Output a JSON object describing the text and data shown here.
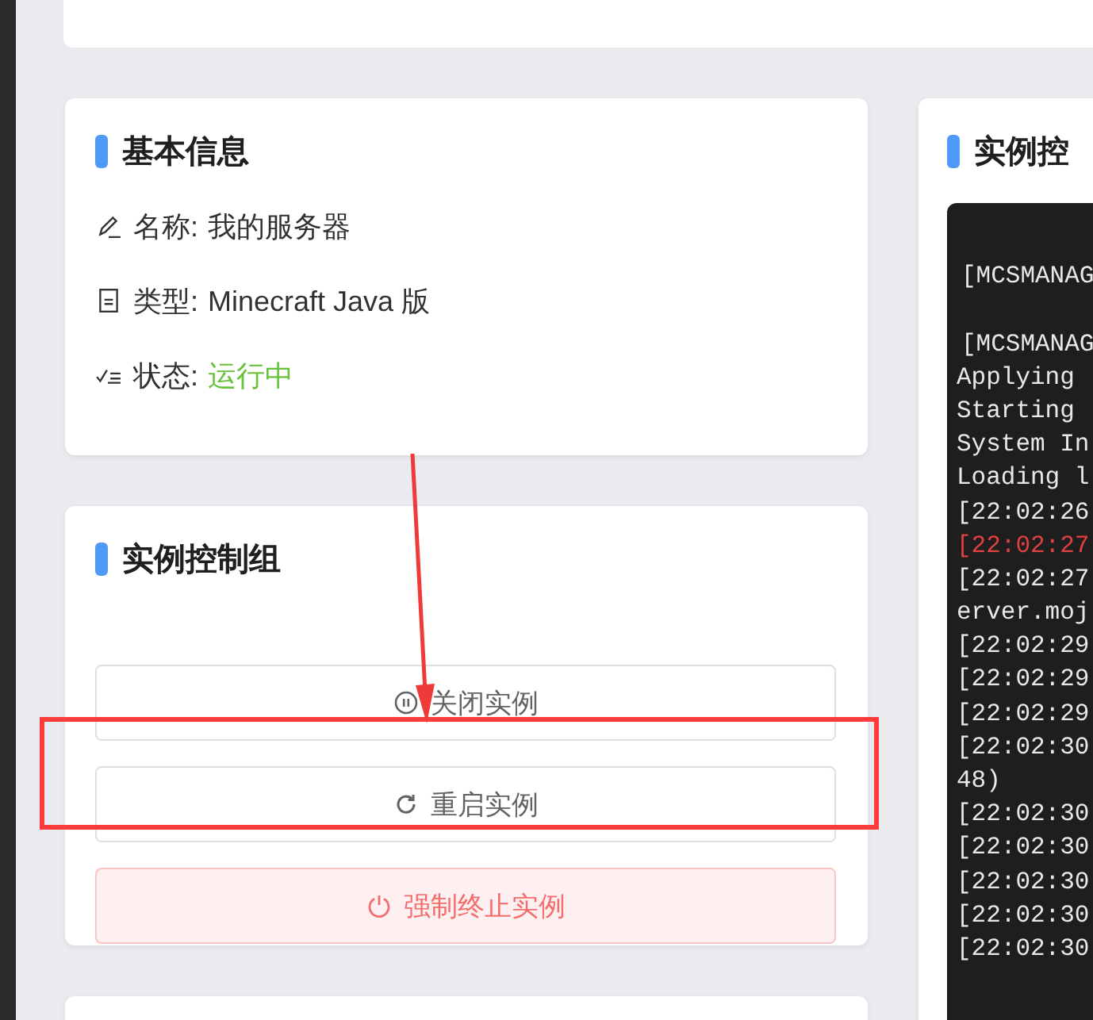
{
  "basic_info": {
    "title": "基本信息",
    "fields": [
      {
        "kind": "name",
        "label": "名称:",
        "value": "我的服务器"
      },
      {
        "kind": "type",
        "label": "类型:",
        "value": "Minecraft Java 版"
      },
      {
        "kind": "status",
        "label": "状态:",
        "value": "运行中"
      }
    ]
  },
  "control_group": {
    "title": "实例控制组",
    "buttons": [
      {
        "kind": "stop",
        "label": "关闭实例"
      },
      {
        "kind": "restart",
        "label": "重启实例"
      },
      {
        "kind": "kill",
        "label": "强制终止实例"
      }
    ]
  },
  "console_panel": {
    "title": "实例控",
    "blocks": [
      [
        {
          "text": "[MCSMANAG",
          "error": false
        }
      ],
      [
        {
          "text": "[MCSMANAG",
          "error": false
        },
        {
          "text": "Applying",
          "error": false
        },
        {
          "text": "Starting",
          "error": false
        },
        {
          "text": "System In",
          "error": false
        },
        {
          "text": "Loading l",
          "error": false
        },
        {
          "text": "[22:02:26",
          "error": false
        },
        {
          "text": "[22:02:27",
          "error": true
        },
        {
          "text": "[22:02:27",
          "error": false
        },
        {
          "text": "erver.moj",
          "error": false
        },
        {
          "text": "[22:02:29",
          "error": false
        },
        {
          "text": "[22:02:29",
          "error": false
        },
        {
          "text": "[22:02:29",
          "error": false
        },
        {
          "text": "[22:02:30",
          "error": false
        },
        {
          "text": "48)",
          "error": false
        },
        {
          "text": "[22:02:30",
          "error": false
        },
        {
          "text": "[22:02:30",
          "error": false
        },
        {
          "text": "[22:02:30",
          "error": false
        },
        {
          "text": "[22:02:30",
          "error": false
        },
        {
          "text": "[22:02:30",
          "error": false
        }
      ]
    ]
  }
}
